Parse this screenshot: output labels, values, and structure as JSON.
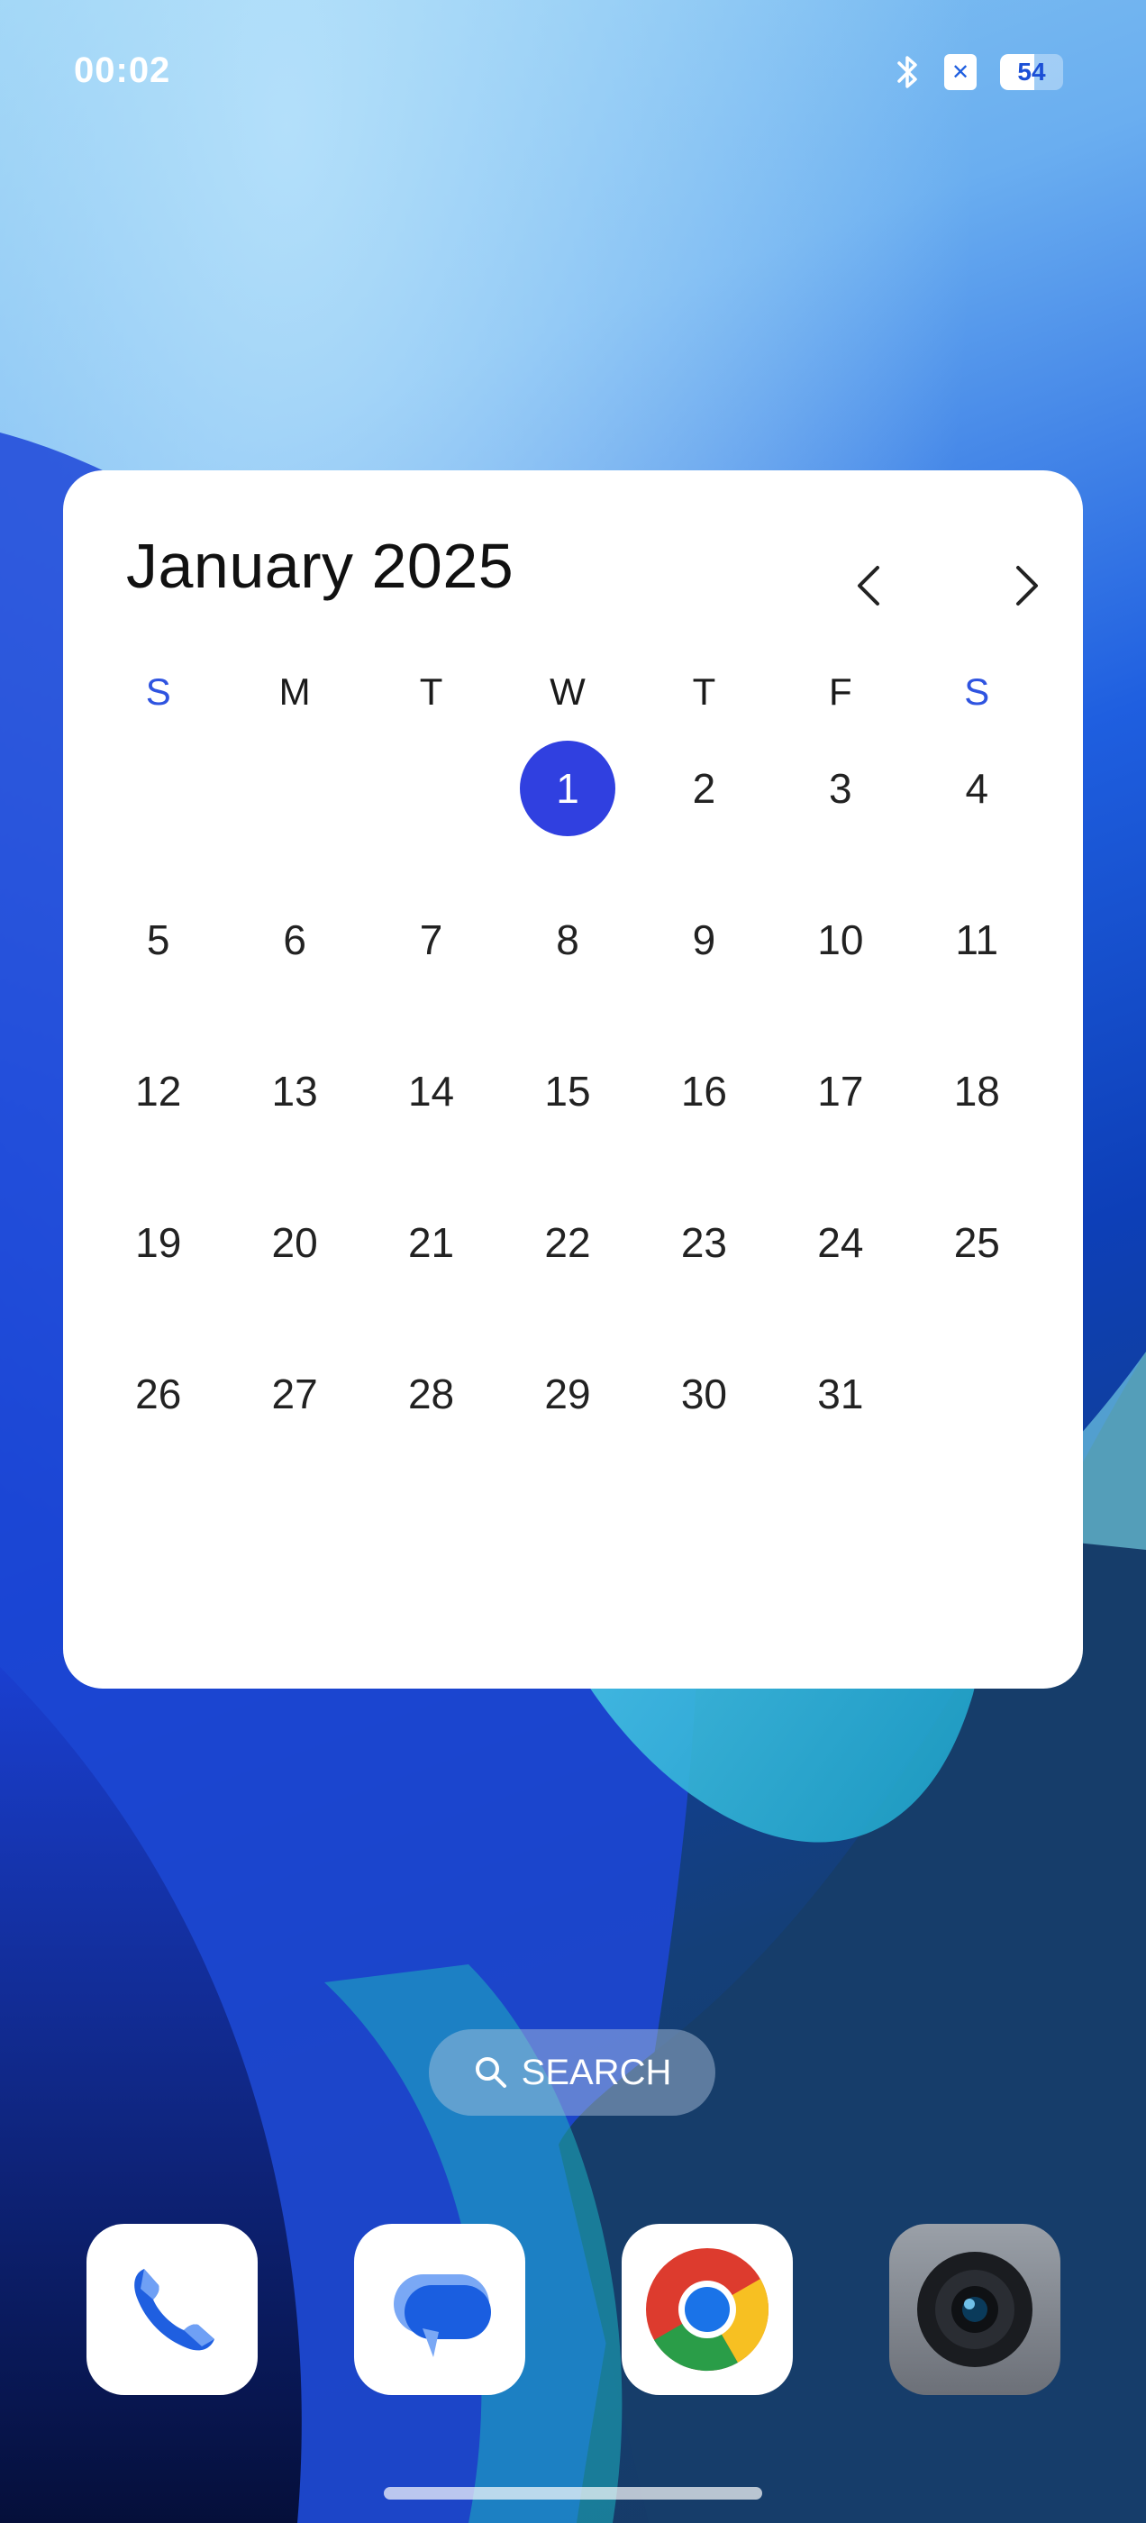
{
  "status_bar": {
    "time": "00:02",
    "sim_icon_glyph": "✕",
    "battery_percent": "54",
    "battery_level": 0.54
  },
  "calendar": {
    "month_title": "January 2025",
    "weekdays": [
      "S",
      "M",
      "T",
      "W",
      "T",
      "F",
      "S"
    ],
    "today": "1",
    "days": [
      "1",
      "2",
      "3",
      "4",
      "5",
      "6",
      "7",
      "8",
      "9",
      "10",
      "11",
      "12",
      "13",
      "14",
      "15",
      "16",
      "17",
      "18",
      "19",
      "20",
      "21",
      "22",
      "23",
      "24",
      "25",
      "26",
      "27",
      "28",
      "29",
      "30",
      "31"
    ],
    "colors": {
      "today_bg": "#3040e0",
      "weekend_header": "#2f54e0"
    }
  },
  "search": {
    "label": "SEARCH"
  },
  "dock": {
    "apps": [
      {
        "name": "phone-icon"
      },
      {
        "name": "messages-icon"
      },
      {
        "name": "chrome-icon"
      },
      {
        "name": "camera-icon"
      }
    ]
  }
}
